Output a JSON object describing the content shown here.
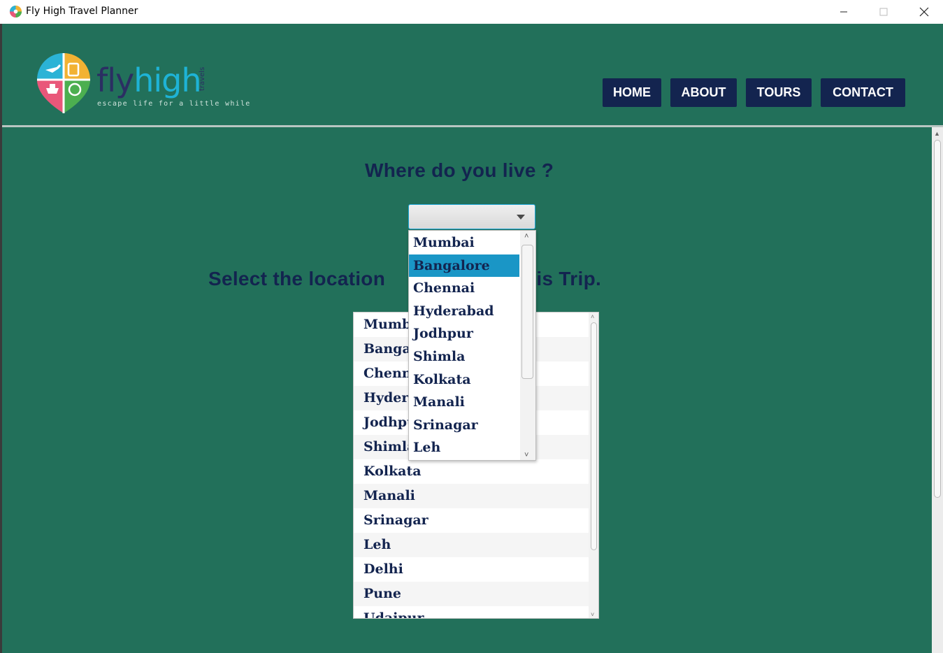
{
  "window": {
    "title": "Fly High Travel Planner",
    "icon": "app-icon",
    "controls": [
      "minimize",
      "maximize",
      "close"
    ]
  },
  "brand": {
    "logo_fly": "fly",
    "logo_high": "high",
    "logo_travels": "travels",
    "tagline": "escape life for a little while"
  },
  "nav": {
    "home": "HOME",
    "about": "ABOUT",
    "tours": "TOURS",
    "contact": "CONTACT"
  },
  "main": {
    "question_home": "Where do you live ?",
    "question_trip": "Select the location        o visit in this Trip.",
    "home_combo": {
      "value": "",
      "options": [
        "Mumbai",
        "Bangalore",
        "Chennai",
        "Hyderabad",
        "Jodhpur",
        "Shimla",
        "Kolkata",
        "Manali",
        "Srinagar",
        "Leh"
      ],
      "highlighted": "Bangalore"
    },
    "trip_list": {
      "items": [
        "Mumbai",
        "Bangalore",
        "Chennai",
        "Hyderabad",
        "Jodhpur",
        "Shimla",
        "Kolkata",
        "Manali",
        "Srinagar",
        "Leh",
        "Delhi",
        "Pune",
        "Udaipur"
      ]
    }
  },
  "colors": {
    "background": "#22705a",
    "nav_button": "#13244f",
    "heading_text": "#13244f",
    "selected_option": "#1a96c6",
    "logo_navy": "#2b2e63",
    "logo_cyan": "#1eb3d6"
  }
}
